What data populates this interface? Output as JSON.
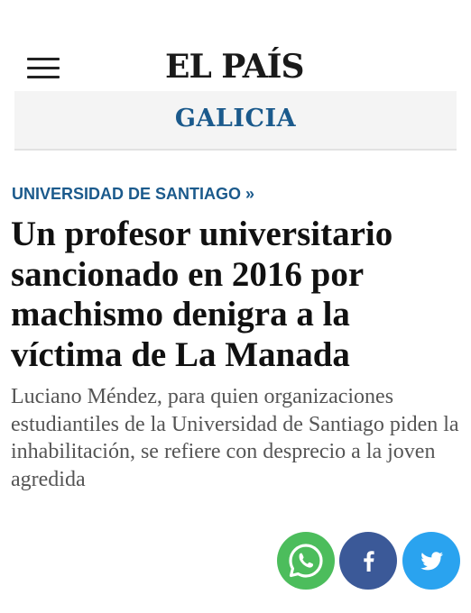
{
  "header": {
    "logo": "EL PAÍS",
    "menu_icon": "hamburger-menu-icon"
  },
  "section": {
    "title": "GALICIA"
  },
  "article": {
    "kicker": "UNIVERSIDAD DE SANTIAGO »",
    "headline": "Un profesor universitario sancionado en 2016 por machismo denigra a la víctima de La Manada",
    "subheadline": "Luciano Méndez, para quien organizaciones estudiantiles de la Universidad de Santiago piden la inhabilitación, se refiere con desprecio a la joven agredida"
  },
  "share": {
    "buttons": [
      {
        "network": "whatsapp",
        "icon": "whatsapp-icon",
        "color": "#4cbd5c"
      },
      {
        "network": "facebook",
        "icon": "facebook-icon",
        "color": "#3b5998"
      },
      {
        "network": "twitter",
        "icon": "twitter-icon",
        "color": "#2aa3ef"
      }
    ]
  },
  "colors": {
    "accent": "#1b5a8c",
    "section_bar": "#f4f4f4",
    "subheadline": "#555555"
  }
}
